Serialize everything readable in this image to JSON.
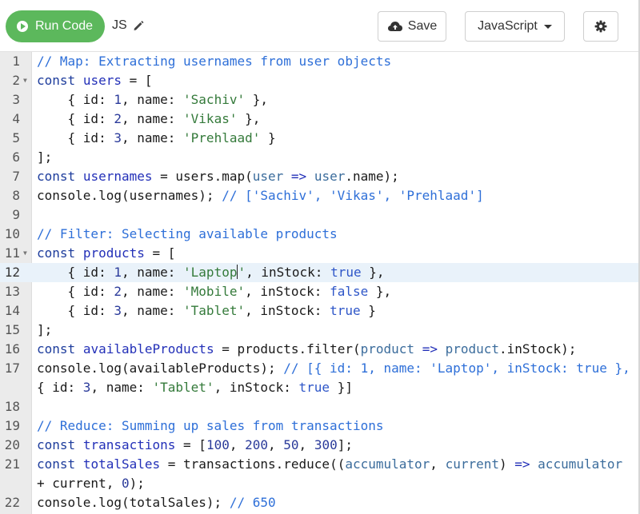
{
  "toolbar": {
    "run_label": "Run Code",
    "file_name": "JS",
    "save_label": "Save",
    "language": "JavaScript"
  },
  "editor": {
    "active_line": 12,
    "lines": [
      {
        "n": "1",
        "fold": "",
        "text": "// Map: Extracting usernames from user objects"
      },
      {
        "n": "2",
        "fold": "▼",
        "text": "const users = ["
      },
      {
        "n": "3",
        "fold": "",
        "text": "    { id: 1, name: 'Sachiv' },"
      },
      {
        "n": "4",
        "fold": "",
        "text": "    { id: 2, name: 'Vikas' },"
      },
      {
        "n": "5",
        "fold": "",
        "text": "    { id: 3, name: 'Prehlaad' }"
      },
      {
        "n": "6",
        "fold": "",
        "text": "];"
      },
      {
        "n": "7",
        "fold": "",
        "text": "const usernames = users.map(user => user.name);"
      },
      {
        "n": "8",
        "fold": "",
        "text": "console.log(usernames); // ['Sachiv', 'Vikas', 'Prehlaad']"
      },
      {
        "n": "9",
        "fold": "",
        "text": ""
      },
      {
        "n": "10",
        "fold": "",
        "text": "// Filter: Selecting available products"
      },
      {
        "n": "11",
        "fold": "▼",
        "text": "const products = ["
      },
      {
        "n": "12",
        "fold": "",
        "text": "    { id: 1, name: 'Laptop', inStock: true },"
      },
      {
        "n": "13",
        "fold": "",
        "text": "    { id: 2, name: 'Mobile', inStock: false },"
      },
      {
        "n": "14",
        "fold": "",
        "text": "    { id: 3, name: 'Tablet', inStock: true }"
      },
      {
        "n": "15",
        "fold": "",
        "text": "];"
      },
      {
        "n": "16",
        "fold": "",
        "text": "const availableProducts = products.filter(product => product.inStock);"
      },
      {
        "n": "17",
        "fold": "",
        "text": "console.log(availableProducts); // [{ id: 1, name: 'Laptop', inStock: true },"
      },
      {
        "n": "",
        "fold": "",
        "text": "{ id: 3, name: 'Tablet', inStock: true }]"
      },
      {
        "n": "18",
        "fold": "",
        "text": ""
      },
      {
        "n": "19",
        "fold": "",
        "text": "// Reduce: Summing up sales from transactions"
      },
      {
        "n": "20",
        "fold": "",
        "text": "const transactions = [100, 200, 50, 300];"
      },
      {
        "n": "21",
        "fold": "",
        "text": "const totalSales = transactions.reduce((accumulator, current) => accumulator"
      },
      {
        "n": "",
        "fold": "",
        "text": "+ current, 0);"
      },
      {
        "n": "22",
        "fold": "",
        "text": "console.log(totalSales); // 650"
      }
    ]
  }
}
